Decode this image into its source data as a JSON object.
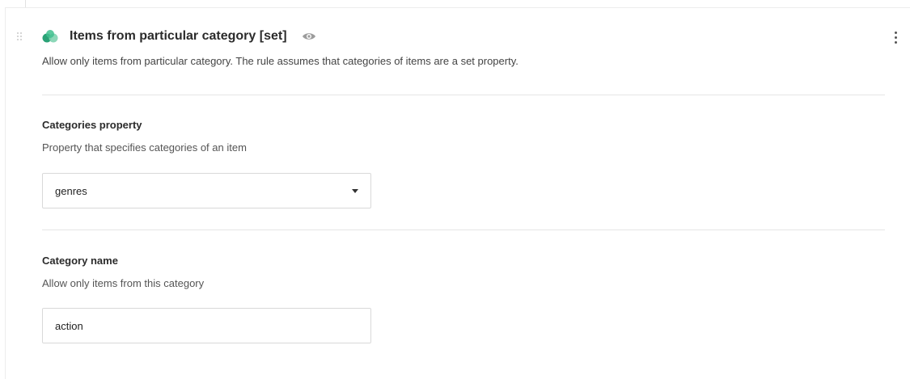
{
  "rule": {
    "title": "Items from particular category [set]",
    "description": "Allow only items from particular category. The rule assumes that categories of items are a set property.",
    "icon": "rule-type-icon",
    "visibility_icon": "eye-icon",
    "menu_icon": "more-vertical-icon",
    "accent_colors": [
      "#2aa276",
      "#7fd3b0"
    ]
  },
  "fields": [
    {
      "label": "Categories property",
      "help": "Property that specifies categories of an item",
      "type": "select",
      "value": "genres"
    },
    {
      "label": "Category name",
      "help": "Allow only items from this category",
      "type": "text",
      "value": "action"
    }
  ]
}
